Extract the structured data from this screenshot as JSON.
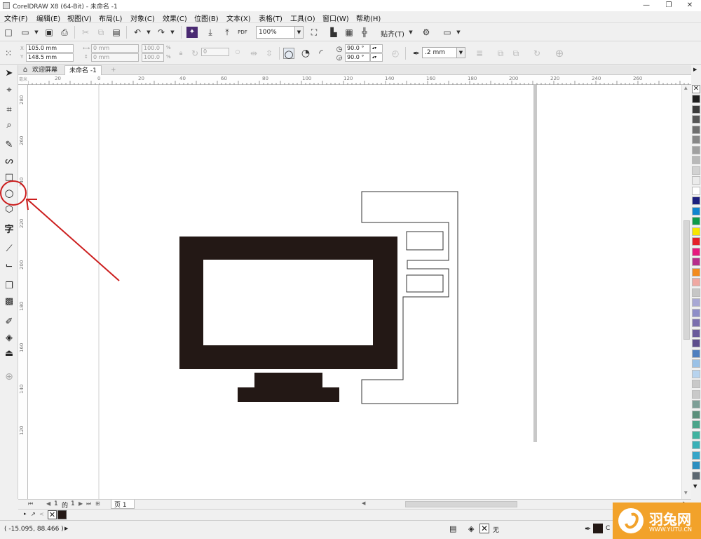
{
  "window": {
    "title": "CorelDRAW X8 (64-Bit) - 未命名 -1",
    "controls": [
      "—",
      "❐",
      "✕"
    ]
  },
  "menu": [
    "文件(F)",
    "编辑(E)",
    "视图(V)",
    "布局(L)",
    "对象(C)",
    "效果(C)",
    "位图(B)",
    "文本(X)",
    "表格(T)",
    "工具(O)",
    "窗口(W)",
    "帮助(H)"
  ],
  "toolbar": {
    "zoom": "100%",
    "snap_label": "贴齐(T)",
    "pdf_label": "PDF"
  },
  "property_bar": {
    "x": "105.0 mm",
    "y": "148.5 mm",
    "width": "0 mm",
    "height": "0 mm",
    "scale_x": "100.0",
    "scale_y": "100.0",
    "percent": "%",
    "rotation": "0",
    "start_angle": "90.0 °",
    "end_angle": "90.0 °",
    "outline_width": ".2 mm"
  },
  "tabs": {
    "welcome": "欢迎屏幕",
    "document": "未命名 -1",
    "add": "+"
  },
  "ruler": {
    "top_labels": [
      "20",
      "0",
      "20",
      "40",
      "60",
      "80",
      "100",
      "120",
      "140",
      "160",
      "180",
      "200",
      "220",
      "240",
      "260"
    ],
    "left_labels": [
      "280",
      "260",
      "240",
      "220",
      "200",
      "180",
      "160",
      "140",
      "120"
    ],
    "unit": "毫米"
  },
  "page_nav": {
    "current": "1",
    "of": "的",
    "total": "1",
    "page_tab": "页 1"
  },
  "status": {
    "coordinates": "( -15.095, 88.466 )",
    "fill_none": "无",
    "outline_text": "C"
  },
  "watermark": {
    "brand": "羽兔网",
    "url": "WWW.YUTU.CN"
  },
  "palette_colors": [
    "#1e1e1e",
    "#3a3a3a",
    "#555555",
    "#6e6e6e",
    "#878787",
    "#a0a0a0",
    "#b9b9b9",
    "#d2d2d2",
    "#ebebeb",
    "#ffffff",
    "#1c1f7e",
    "#0f84cf",
    "#0d9a49",
    "#f6e600",
    "#e4202a",
    "#e6197f",
    "#b62d8b",
    "#f28b1e",
    "#f0a8a2",
    "#c6c6c6",
    "#a8a8d4",
    "#8e8ec8",
    "#7b6fae",
    "#6a5a9b",
    "#5e4e8c",
    "#4f7fbf",
    "#9ac1e6",
    "#b7d3ee",
    "#c9c9c9",
    "#c9c9c9",
    "#7d9e96",
    "#5b8f7b",
    "#4aa489",
    "#3fb3a0",
    "#39b0b7",
    "#36a5c8",
    "#2b8ec0",
    "#5b6770"
  ],
  "accent": "#cc1e1e",
  "shape_fill": "#231815"
}
